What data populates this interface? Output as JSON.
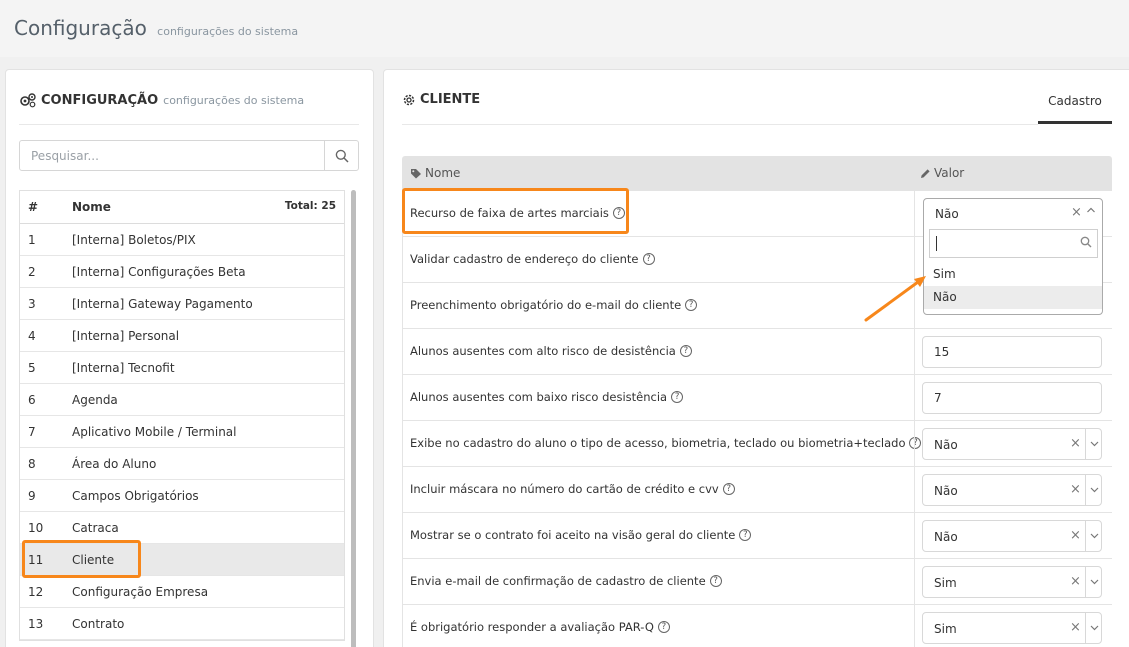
{
  "page": {
    "title": "Configuração",
    "subtitle": "configurações do sistema"
  },
  "left": {
    "heading": "CONFIGURAÇÃO",
    "heading_sub": "configurações do sistema",
    "search_placeholder": "Pesquisar...",
    "list_header": {
      "hash": "#",
      "name": "Nome",
      "total": "Total: 25"
    },
    "items": [
      {
        "num": "1",
        "label": "[Interna] Boletos/PIX"
      },
      {
        "num": "2",
        "label": "[Interna] Configurações Beta"
      },
      {
        "num": "3",
        "label": "[Interna] Gateway Pagamento"
      },
      {
        "num": "4",
        "label": "[Interna] Personal"
      },
      {
        "num": "5",
        "label": "[Interna] Tecnofit"
      },
      {
        "num": "6",
        "label": "Agenda"
      },
      {
        "num": "7",
        "label": "Aplicativo Mobile / Terminal"
      },
      {
        "num": "8",
        "label": "Área do Aluno"
      },
      {
        "num": "9",
        "label": "Campos Obrigatórios"
      },
      {
        "num": "10",
        "label": "Catraca"
      },
      {
        "num": "11",
        "label": "Cliente"
      },
      {
        "num": "12",
        "label": "Configuração Empresa"
      },
      {
        "num": "13",
        "label": "Contrato"
      }
    ]
  },
  "right": {
    "heading": "CLIENTE",
    "tab": "Cadastro",
    "col_name": "Nome",
    "col_value": "Valor",
    "rows": [
      {
        "label": "Recurso de faixa de artes marciais",
        "value": "Não"
      },
      {
        "label": "Validar cadastro de endereço do cliente",
        "value": ""
      },
      {
        "label": "Preenchimento obrigatório do e-mail do cliente",
        "value": ""
      },
      {
        "label": "Alunos ausentes com alto risco de desistência",
        "value": "15"
      },
      {
        "label": "Alunos ausentes com baixo risco desistência",
        "value": "7"
      },
      {
        "label": "Exibe no cadastro do aluno o tipo de acesso, biometria, teclado ou biometria+teclado",
        "value": "Não"
      },
      {
        "label": "Incluir máscara no número do cartão de crédito e cvv",
        "value": "Não"
      },
      {
        "label": "Mostrar se o contrato foi aceito na visão geral do cliente",
        "value": "Não"
      },
      {
        "label": "Envia e-mail de confirmação de cadastro de cliente",
        "value": "Sim"
      },
      {
        "label": "É obrigatório responder a avaliação PAR-Q",
        "value": "Sim"
      }
    ],
    "dropdown": {
      "current": "Não",
      "options": [
        "Sim",
        "Não"
      ]
    }
  },
  "icons": {
    "clear": "×",
    "help": "?"
  },
  "colors": {
    "highlight": "#f7871b"
  }
}
